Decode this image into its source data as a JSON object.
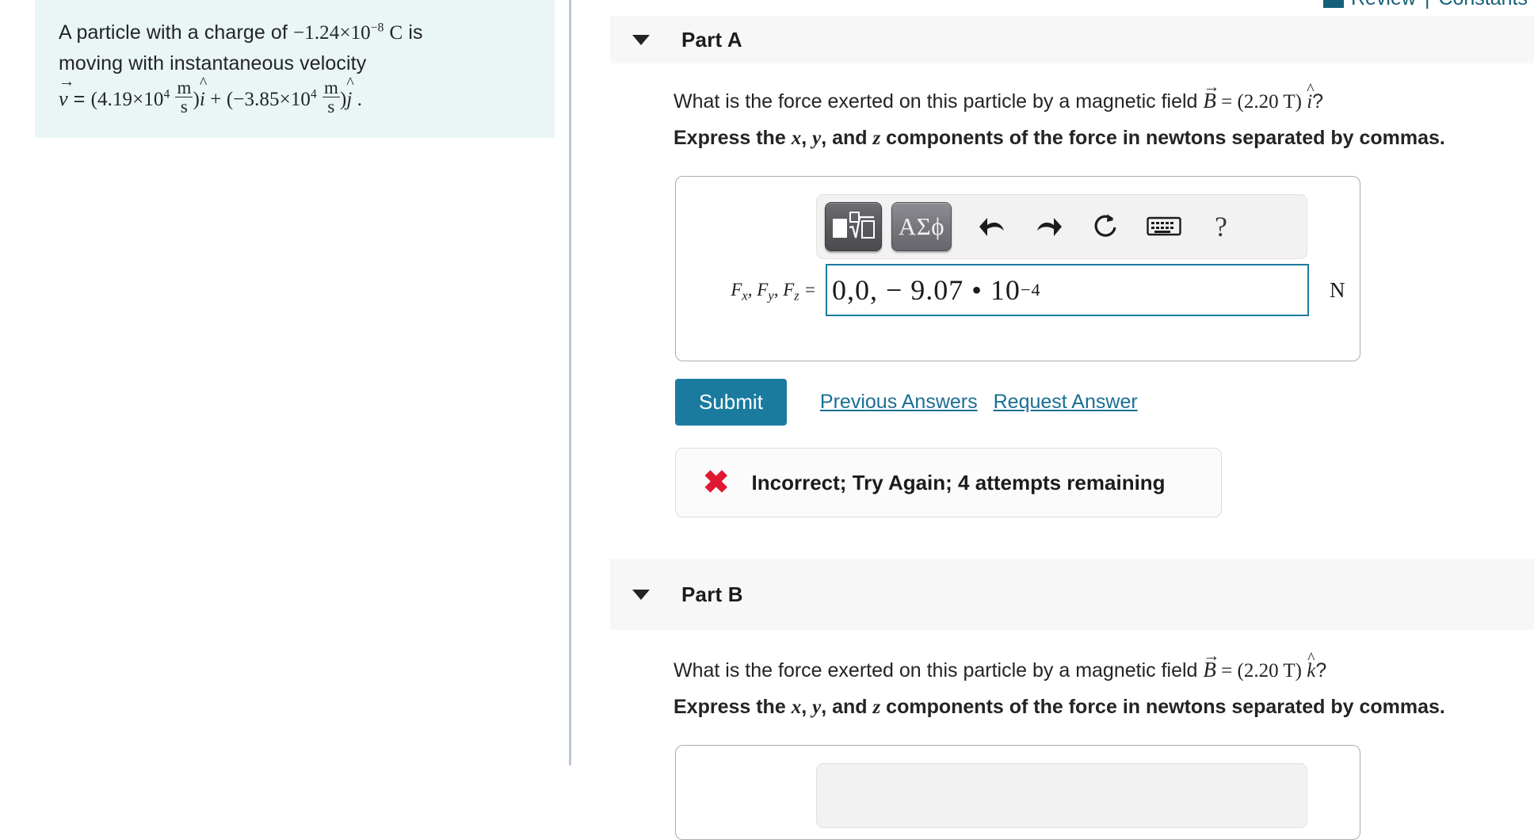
{
  "problem": {
    "line1_prefix": "A particle with a charge of ",
    "charge_value": "−1.24×10",
    "charge_exponent": "−8",
    "charge_unit": "C",
    "line1_suffix": " is",
    "line2": "moving with instantaneous velocity",
    "velocity_symbol": "v",
    "velocity_equals": " = ",
    "term1": "(4.19×10",
    "term1_exp": "4",
    "unit_num": "m",
    "unit_den": "s",
    "term1_close": ")",
    "term1_hat": "i",
    "plus": " + ",
    "term2": "(−3.85×10",
    "term2_exp": "4",
    "term2_close": ")",
    "term2_hat": "j",
    "period": " ."
  },
  "review_bar": {
    "review_label": "Review",
    "separator": "|",
    "constants_label": "Constants",
    "color": "#14607a"
  },
  "parts": [
    {
      "title": "Part A",
      "question_prefix": "What is the force exerted on this particle by a magnetic field ",
      "question_symbol": "B",
      "question_mid": " = (2.20 T) ",
      "question_hat": "i",
      "question_suffix": "?",
      "instruction_prefix": "Express the ",
      "instruction_x": "x",
      "instruction_y": "y",
      "instruction_z": "z",
      "instruction_mid1": ", ",
      "instruction_mid2": ", and ",
      "instruction_suffix": " components of the force in newtons separated by commas.",
      "answer_label_f": "F",
      "answer_label_sub_x": "x",
      "answer_label_sub_y": "y",
      "answer_label_sub_z": "z",
      "answer_value": "0,0, − 9.07 • 10",
      "answer_value_exp": "−4",
      "unit": "N"
    },
    {
      "title": "Part B",
      "question_prefix": "What is the force exerted on this particle by a magnetic field ",
      "question_symbol": "B",
      "question_mid": " = (2.20 T) ",
      "question_hat": "k",
      "question_suffix": "?",
      "instruction_prefix": "Express the ",
      "instruction_x": "x",
      "instruction_y": "y",
      "instruction_z": "z",
      "instruction_mid1": ", ",
      "instruction_mid2": ", and ",
      "instruction_suffix": " components of the force in newtons separated by commas."
    }
  ],
  "toolbar": {
    "template_button": "math-template",
    "greek_button": "ΑΣϕ",
    "undo_button": "undo",
    "redo_button": "redo",
    "reset_button": "reset",
    "keyboard_button": "keyboard",
    "help_button": "?"
  },
  "actions": {
    "submit_label": "Submit",
    "previous_answers_label": "Previous Answers",
    "request_answer_label": "Request Answer",
    "submit_color": "#1a7b9e",
    "link_color": "#1a6f93"
  },
  "feedback": {
    "icon": "incorrect-x",
    "message": "Incorrect; Try Again; 4 attempts remaining",
    "icon_color": "#e01932"
  }
}
